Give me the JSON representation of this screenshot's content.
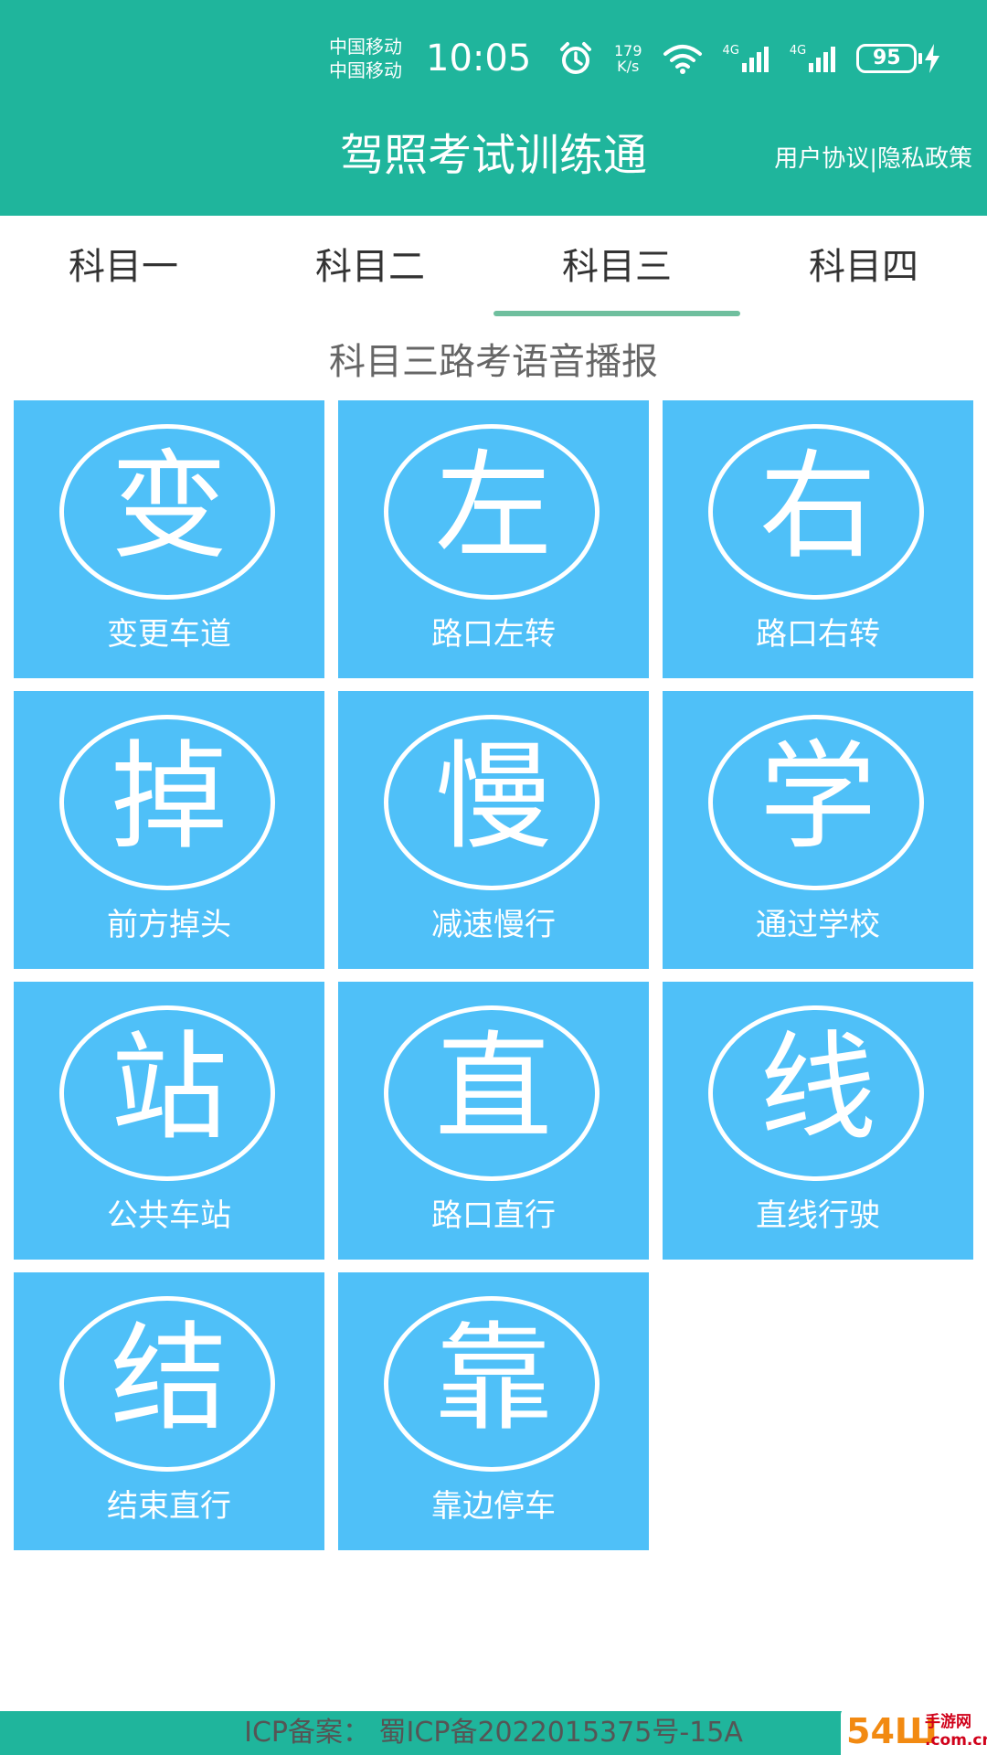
{
  "status_bar": {
    "carrier_1": "中国移动",
    "carrier_2": "中国移动",
    "time": "10:05",
    "net_speed_value": "179",
    "net_speed_unit": "K/s",
    "signal_1_label": "4G",
    "signal_2_label": "4G",
    "battery_level": "95",
    "icons": [
      "alarm-icon",
      "wifi-icon",
      "signal-icon",
      "signal-icon",
      "battery-icon",
      "charging-icon"
    ]
  },
  "header": {
    "title": "驾照考试训练通",
    "link_label": "用户协议|隐私政策"
  },
  "tabs": [
    {
      "label": "科目一",
      "active": false
    },
    {
      "label": "科目二",
      "active": false
    },
    {
      "label": "科目三",
      "active": true
    },
    {
      "label": "科目四",
      "active": false
    }
  ],
  "section_title": "科目三路考语音播报",
  "tiles": [
    {
      "glyph": "变",
      "label": "变更车道"
    },
    {
      "glyph": "左",
      "label": "路口左转"
    },
    {
      "glyph": "右",
      "label": "路口右转"
    },
    {
      "glyph": "掉",
      "label": "前方掉头"
    },
    {
      "glyph": "慢",
      "label": "减速慢行"
    },
    {
      "glyph": "学",
      "label": "通过学校"
    },
    {
      "glyph": "站",
      "label": "公共车站"
    },
    {
      "glyph": "直",
      "label": "路口直行"
    },
    {
      "glyph": "线",
      "label": "直线行驶"
    },
    {
      "glyph": "结",
      "label": "结束直行"
    },
    {
      "glyph": "靠",
      "label": "靠边停车"
    }
  ],
  "footer": {
    "icp_text": "ICP备案： 蜀ICP备2022015375号-15A"
  },
  "watermark": {
    "main": "54Ш",
    "side_top": "手游网",
    "side_bottom": ".com.cn"
  },
  "colors": {
    "header_bg": "#1fb59c",
    "tile_bg": "#4fc0f8",
    "tab_indicator": "#6fbf9e"
  }
}
